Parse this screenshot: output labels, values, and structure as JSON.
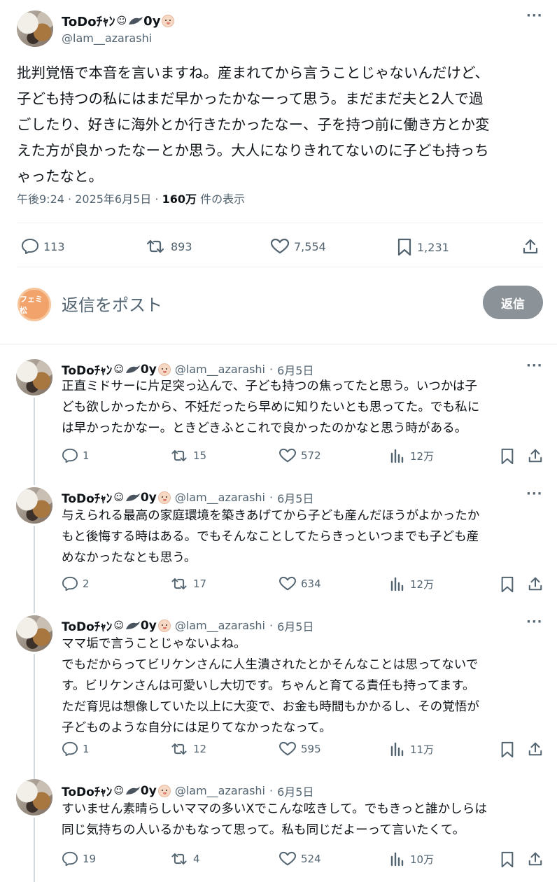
{
  "main_tweet": {
    "display_name": "ToDoﾁｬﾝ",
    "name_emojis": [
      "smiley-face-icon",
      "seal-icon",
      "baby-face-icon"
    ],
    "name_suffix": "0y",
    "handle": "@lam__azarashi",
    "more_icon": "more-dots-icon",
    "text_lines": [
      "批判覚悟で本音を言いますね。産まれてから言うことじゃないんだけど、",
      "子ども持つの私にはまだ早かったかなーって思う。まだまだ夫と2人で過",
      "ごしたり、好きに海外とか行きたかったなー、子を持つ前に働き方とか変",
      "えた方が良かったなーとか思う。大人になりきれてないのに子ども持っち",
      "ゃったなと。"
    ],
    "time": "午後9:24",
    "date": "2025年6月5日",
    "views": "160万",
    "views_label": "件の表示",
    "stats": {
      "replies": "113",
      "reposts": "893",
      "likes": "7,554",
      "bookmarks": "1,231"
    }
  },
  "reply_composer": {
    "avatar_text": "フェミ松",
    "placeholder": "返信をポスト",
    "button_label": "返信"
  },
  "replies": [
    {
      "display_name": "ToDoﾁｬﾝ",
      "name_suffix": "0y",
      "handle": "@lam__azarashi",
      "date": "6月5日",
      "text_lines": [
        "正直ミドサーに片足突っ込んで、子ども持つの焦ってたと思う。いつかは子",
        "ども欲しかったから、不妊だったら早めに知りたいとも思ってた。でも私に",
        "は早かったかなー。ときどきふとこれで良かったのかなと思う時がある。"
      ],
      "stats": {
        "replies": "1",
        "reposts": "15",
        "likes": "572",
        "views": "12万"
      }
    },
    {
      "display_name": "ToDoﾁｬﾝ",
      "name_suffix": "0y",
      "handle": "@lam__azarashi",
      "date": "6月5日",
      "text_lines": [
        "与えられる最高の家庭環境を築きあげてから子ども産んだほうがよかったか",
        "もと後悔する時はある。でもそんなことしてたらきっといつまでも子ども産",
        "めなかったなとも思う。"
      ],
      "stats": {
        "replies": "2",
        "reposts": "17",
        "likes": "634",
        "views": "12万"
      }
    },
    {
      "display_name": "ToDoﾁｬﾝ",
      "name_suffix": "0y",
      "handle": "@lam__azarashi",
      "date": "6月5日",
      "text_lines": [
        "ママ垢で言うことじゃないよね。",
        "でもだからってビリケンさんに人生潰されたとかそんなことは思ってないで",
        "す。ビリケンさんは可愛いし大切です。ちゃんと育てる責任も持ってます。",
        "ただ育児は想像していた以上に大変で、お金も時間もかかるし、その覚悟が",
        "子どものような自分には足りてなかったなって。"
      ],
      "stats": {
        "replies": "1",
        "reposts": "12",
        "likes": "595",
        "views": "11万"
      }
    },
    {
      "display_name": "ToDoﾁｬﾝ",
      "name_suffix": "0y",
      "handle": "@lam__azarashi",
      "date": "6月5日",
      "text_lines": [
        "すいません素晴らしいママの多いXでこんな呟きして。でもきっと誰かしらは",
        "同じ気持ちの人いるかもなって思って。私も同じだよーって言いたくて。"
      ],
      "stats": {
        "replies": "19",
        "reposts": "4",
        "likes": "524",
        "views": "10万"
      }
    }
  ],
  "colors": {
    "text": "#0f1419",
    "secondary": "#536471",
    "divider": "#eff3f4",
    "thread_line": "#cfd9de",
    "reply_button": "#8b9298"
  }
}
